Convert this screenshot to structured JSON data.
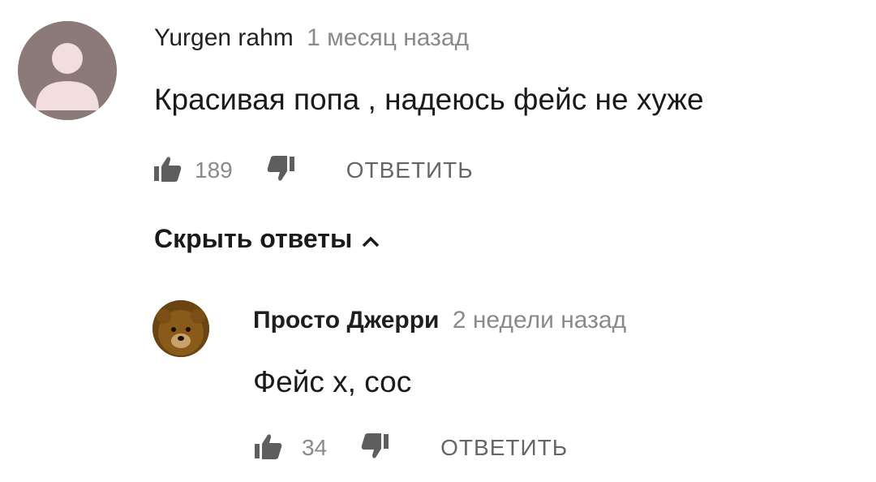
{
  "main_comment": {
    "author": "Yurgen rahm",
    "time": "1 месяц назад",
    "text": "Красивая попа , надеюсь фейс не хуже",
    "likes": "189",
    "reply_label": "ОТВЕТИТЬ",
    "avatar_icon": "default-user-avatar",
    "avatar_color": "#8c7a78"
  },
  "replies_toggle": {
    "label": "Скрыть ответы",
    "icon": "chevron-up-icon"
  },
  "reply_comment": {
    "author": "Просто Джерри",
    "time": "2 недели назад",
    "text": "Фейс х, сос",
    "likes": "34",
    "reply_label": "ОТВЕТИТЬ",
    "avatar_icon": "bear-avatar"
  }
}
